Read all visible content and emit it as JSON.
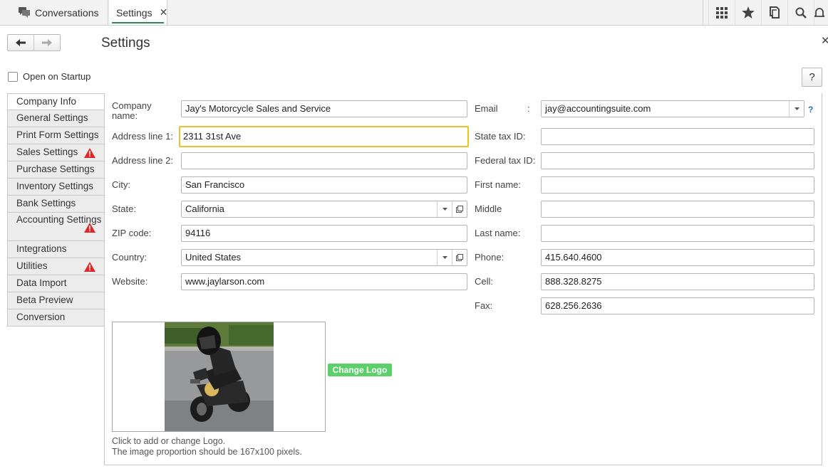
{
  "tabs": {
    "conversations": "Conversations",
    "settings": "Settings"
  },
  "toolbar_icons": [
    "apps-grid-icon",
    "star-icon",
    "history-icon",
    "search-icon",
    "bell-icon"
  ],
  "page": {
    "title": "Settings",
    "open_on_startup_label": "Open on Startup",
    "open_on_startup_checked": false,
    "help_label": "?"
  },
  "sidebar": {
    "items": [
      {
        "label": "Company Info",
        "warning": false
      },
      {
        "label": "General Settings",
        "warning": false
      },
      {
        "label": "Print Form Settings",
        "warning": false
      },
      {
        "label": "Sales Settings",
        "warning": true
      },
      {
        "label": "Purchase Settings",
        "warning": false
      },
      {
        "label": "Inventory Settings",
        "warning": false
      },
      {
        "label": "Bank Settings",
        "warning": false
      },
      {
        "label": "Accounting Settings",
        "warning": true
      },
      {
        "label": "Integrations",
        "warning": false
      },
      {
        "label": "Utilities",
        "warning": true
      },
      {
        "label": "Data Import",
        "warning": false
      },
      {
        "label": "Beta Preview",
        "warning": false
      },
      {
        "label": "Conversion",
        "warning": false
      }
    ]
  },
  "form": {
    "company_name": {
      "label_line1": "Company",
      "label_line2": "name:",
      "value": "Jay's Motorcycle Sales and Service"
    },
    "address1": {
      "label": "Address line 1:",
      "value": "2311 31st Ave"
    },
    "address2": {
      "label": "Address line 2:",
      "value": ""
    },
    "city": {
      "label": "City:",
      "value": "San Francisco"
    },
    "state": {
      "label": "State:",
      "value": "California"
    },
    "zip": {
      "label": "ZIP code:",
      "value": "94116"
    },
    "country": {
      "label": "Country:",
      "value": "United States"
    },
    "website": {
      "label": "Website:",
      "value": "www.jaylarson.com"
    },
    "email": {
      "label": "Email",
      "colon": ":",
      "value": "jay@accountingsuite.com",
      "help": "?"
    },
    "state_tax_id": {
      "label": "State tax ID:",
      "value": ""
    },
    "federal_tax_id": {
      "label": "Federal tax ID:",
      "value": ""
    },
    "first_name": {
      "label": "First name:",
      "value": ""
    },
    "middle": {
      "label": "Middle",
      "value": ""
    },
    "last_name": {
      "label": "Last name:",
      "value": ""
    },
    "phone": {
      "label": "Phone:",
      "value": "415.640.4600"
    },
    "cell": {
      "label": "Cell:",
      "value": "888.328.8275"
    },
    "fax": {
      "label": "Fax:",
      "value": "628.256.2636"
    }
  },
  "logo": {
    "change_label": "Change Logo",
    "hint_line1": "Click to add or change Logo.",
    "hint_line2": "The image proportion should be 167x100 pixels."
  },
  "colors": {
    "accent_tab_underline": "#2e8b57",
    "focus_border": "#e8c42a",
    "change_logo_bg": "#5bd06a",
    "warning": "#e0262b"
  }
}
